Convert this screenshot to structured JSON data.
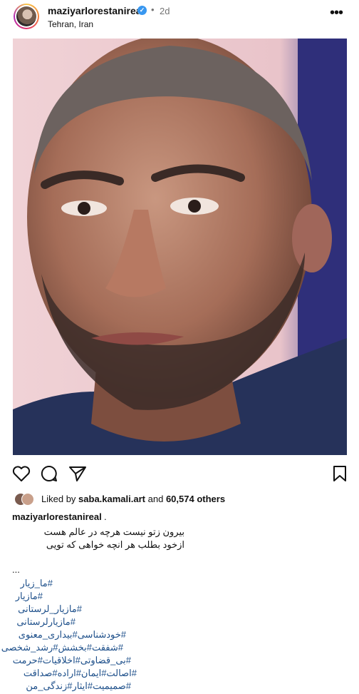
{
  "post": {
    "username": "maziyarlorestanireal",
    "verified_mark": "✓",
    "separator": "•",
    "time": "2d",
    "location": "Tehran, Iran",
    "more_label": "•••"
  },
  "image": {
    "subject": "portrait photo of a man with graying hair and beard",
    "background_color": "#e8c7cc"
  },
  "actions": {
    "icons": [
      "heart-icon",
      "comment-icon",
      "share-icon",
      "bookmark-icon"
    ]
  },
  "likes": {
    "prefix": "Liked by",
    "user": "saba.kamali.art",
    "middle": "and",
    "count": "60,574 others"
  },
  "caption": {
    "username": "maziyarlorestanireal",
    "trailing": ".",
    "lines": [
      "بیرون زتو نیست هرچه در عالم هست",
      "ازخود بطلب هر انچه خواهی که تویی"
    ],
    "ellipsis": "...",
    "hashtags": [
      "#ما_زیار",
      "#مازیار",
      "#مازیار_لرستانی",
      "#مازیارلرستانی",
      "#خودشناسی#بیداری_معنوی",
      "#شفقت#بخشش#رشد_شخصی",
      "#بی_قضاوتی#اخلاقیات#حرمت",
      "#اصالت#ایمان#اراده#صداقت",
      "#صمیمیت#ایثار#زندگی_من"
    ]
  },
  "colors": {
    "hashtag": "#1d4f8a",
    "verified": "#3897f0",
    "secondary_text": "#737373"
  }
}
